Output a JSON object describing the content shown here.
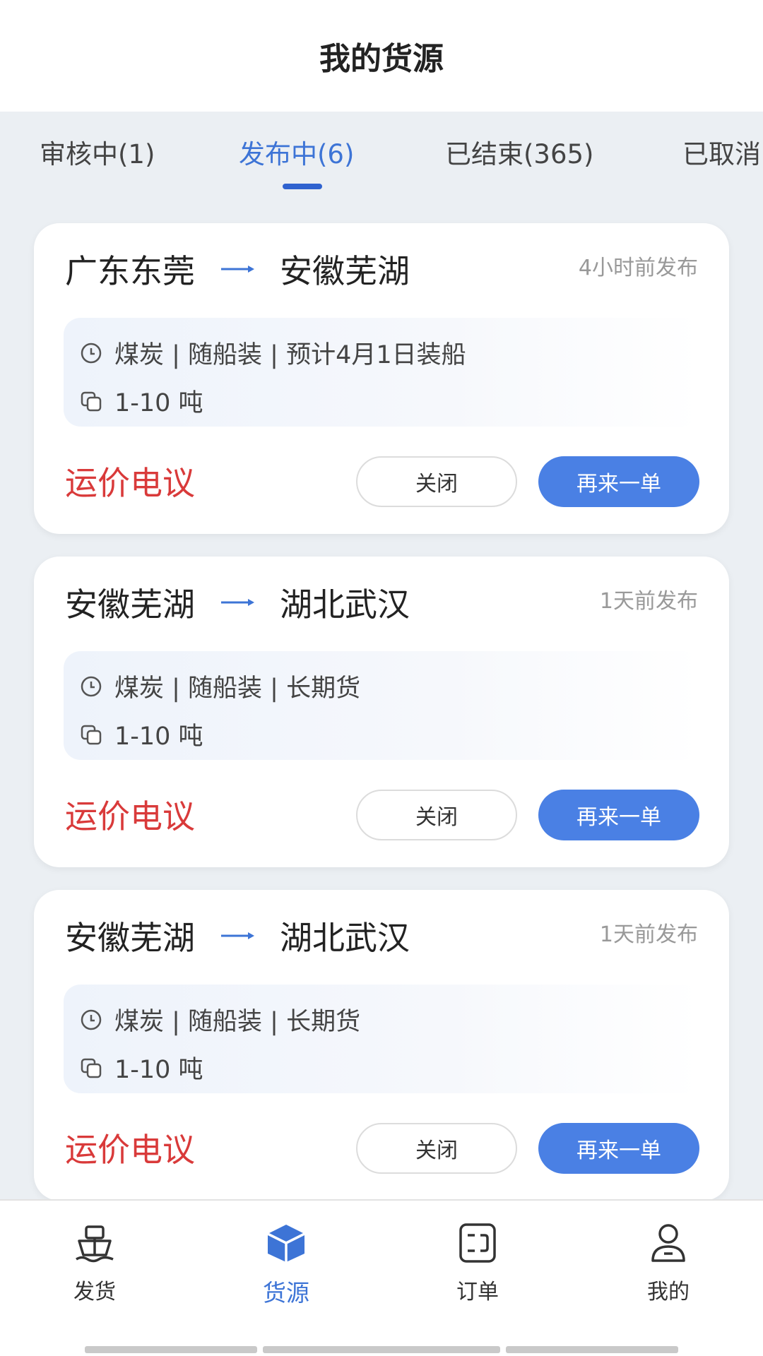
{
  "header": {
    "title": "我的货源"
  },
  "tabs": [
    {
      "label": "审核中(1)"
    },
    {
      "label": "发布中(6)"
    },
    {
      "label": "已结束(365)"
    },
    {
      "label": "已取消"
    }
  ],
  "cards": [
    {
      "origin": "广东东莞",
      "destination": "安徽芜湖",
      "posted": "4小时前发布",
      "detail": "煤炭 | 随船装 | 预计4月1日装船",
      "weight": "1-10 吨",
      "price": "运价电议",
      "close_label": "关闭",
      "again_label": "再来一单"
    },
    {
      "origin": "安徽芜湖",
      "destination": "湖北武汉",
      "posted": "1天前发布",
      "detail": "煤炭 | 随船装 | 长期货",
      "weight": "1-10 吨",
      "price": "运价电议",
      "close_label": "关闭",
      "again_label": "再来一单"
    },
    {
      "origin": "安徽芜湖",
      "destination": "湖北武汉",
      "posted": "1天前发布",
      "detail": "煤炭 | 随船装 | 长期货",
      "weight": "1-10 吨",
      "price": "运价电议",
      "close_label": "关闭",
      "again_label": "再来一单"
    }
  ],
  "nav": [
    {
      "label": "发货",
      "icon": "ship-icon"
    },
    {
      "label": "货源",
      "icon": "cube-icon"
    },
    {
      "label": "订单",
      "icon": "order-icon"
    },
    {
      "label": "我的",
      "icon": "user-icon"
    }
  ],
  "colors": {
    "accent": "#3d74d6",
    "price": "#d93a3a",
    "button_primary": "#4a80e4"
  }
}
